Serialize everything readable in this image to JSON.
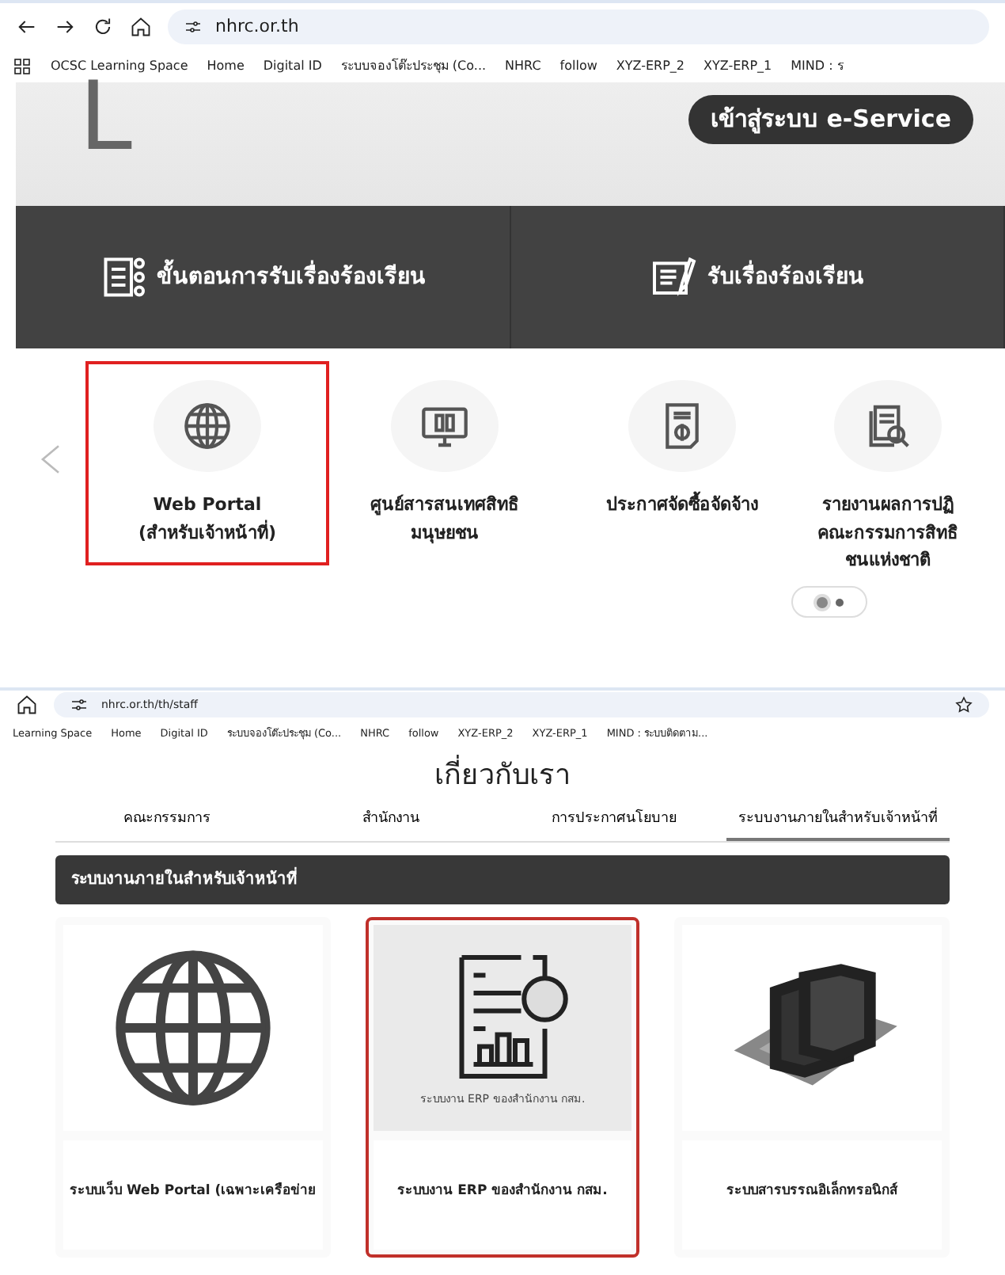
{
  "screens": [
    {
      "url": "nhrc.or.th",
      "bookmarks": [
        "OCSC Learning Space",
        "Home",
        "Digital ID",
        "ระบบจองโต๊ะประชุม (Co...",
        "NHRC",
        "follow",
        "XYZ-ERP_2",
        "XYZ-ERP_1",
        "MIND : ร"
      ],
      "hero": {
        "letter": "L",
        "button": "เข้าสู่ระบบ e-Service"
      },
      "band": [
        {
          "label": "ขั้นตอนการรับเรื่องร้องเรียน"
        },
        {
          "label": "รับเรื่องร้องเรียน"
        }
      ],
      "carousel": [
        {
          "kind": "globe",
          "label": "Web Portal\n(สำหรับเจ้าหน้าที่)",
          "highlighted": true
        },
        {
          "kind": "monitor",
          "label": "ศูนย์สารสนเทศสิทธิ\nมนุษยชน",
          "highlighted": false
        },
        {
          "kind": "invoice",
          "label": "ประกาศจัดซื้อจัดจ้าง",
          "highlighted": false
        },
        {
          "kind": "report",
          "label": "รายงานผลการปฏิ\nคณะกรรมการสิทธิ\nชนแห่งชาติ",
          "highlighted": false
        }
      ],
      "pager": [
        {
          "selected": true
        },
        {
          "selected": false
        }
      ]
    },
    {
      "url": "nhrc.or.th/th/staff",
      "bookmarks": [
        "Learning Space",
        "Home",
        "Digital ID",
        "ระบบจองโต๊ะประชุม (Co...",
        "NHRC",
        "follow",
        "XYZ-ERP_2",
        "XYZ-ERP_1",
        "MIND : ระบบติดตาม..."
      ],
      "heading": "เกี่ยวกับเรา",
      "tabs": [
        {
          "label": "คณะกรรมการ",
          "selected": false
        },
        {
          "label": "สำนักงาน",
          "selected": false
        },
        {
          "label": "การประกาศนโยบาย",
          "selected": false
        },
        {
          "label": "ระบบงานภายในสำหรับเจ้าหน้าที่",
          "selected": true
        }
      ],
      "section_title": "ระบบงานภายในสำหรับเจ้าหน้าที่",
      "cards": [
        {
          "kind": "globe",
          "title": "ระบบเว็บ Web Portal (เฉพาะเครือข่าย",
          "highlighted": false
        },
        {
          "kind": "erp",
          "caption": "ระบบงาน ERP ของสำนักงาน กสม.",
          "title": "ระบบงาน ERP ของสำนักงาน กสม.",
          "highlighted": true
        },
        {
          "kind": "books",
          "title": "ระบบสารบรรณอิเล็กทรอนิกส์",
          "highlighted": false
        }
      ]
    }
  ]
}
